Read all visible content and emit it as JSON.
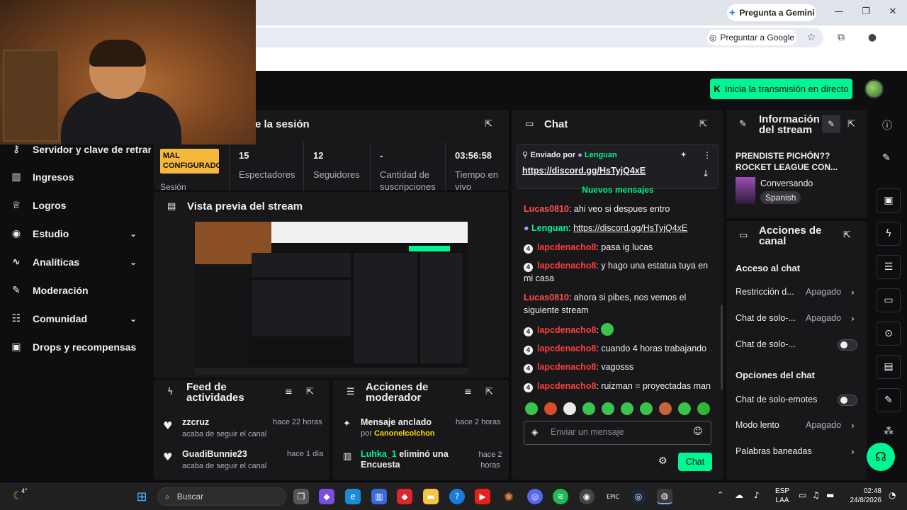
{
  "browser": {
    "gemini_label": "Pregunta a Gemini",
    "ask_google_label": "Preguntar a Google"
  },
  "header": {
    "go_live_label": "Inicia la transmisión en directo"
  },
  "sidebar": {
    "items": [
      {
        "label": "Servidor y clave de retrans",
        "icon": "key-icon"
      },
      {
        "label": "Ingresos",
        "icon": "chart-icon"
      },
      {
        "label": "Logros",
        "icon": "trophy-icon"
      },
      {
        "label": "Estudio",
        "icon": "camera-icon"
      },
      {
        "label": "Analíticas",
        "icon": "analytics-icon"
      },
      {
        "label": "Moderación",
        "icon": "wrench-icon"
      },
      {
        "label": "Comunidad",
        "icon": "people-icon"
      },
      {
        "label": "Drops y recompensas",
        "icon": "gift-icon"
      }
    ]
  },
  "session": {
    "title": "e la sesión",
    "status_badge": "MAL CONFIGURADO",
    "status_label": "Sesión",
    "stats": [
      {
        "value": "15",
        "label": "Espectadores"
      },
      {
        "value": "12",
        "label": "Seguidores"
      },
      {
        "value": "-",
        "label": "Cantidad de suscripciones"
      },
      {
        "value": "03:56:58",
        "label": "Tiempo en vivo"
      }
    ]
  },
  "preview": {
    "title": "Vista previa del stream"
  },
  "activity_feed": {
    "title": "Feed de actividades",
    "items": [
      {
        "user": "zzcruz",
        "action": "acaba de seguir el canal",
        "time": "hace 22 horas"
      },
      {
        "user": "GuadiBunnie23",
        "action": "acaba de seguir el canal",
        "time": "hace 1 día"
      }
    ]
  },
  "mod_actions": {
    "title": "Acciones de moderador",
    "items": [
      {
        "text": "Mensaje anclado",
        "by_prefix": "por ",
        "by": "Canonelcolchon",
        "time": "hace 2 horas"
      },
      {
        "user": "Luhka_1",
        "text": " eliminó una Encuesta",
        "time": "hace 2 horas"
      }
    ]
  },
  "chat": {
    "title": "Chat",
    "pinned_prefix": "Enviado por",
    "pinned_user": "Lenguan",
    "pinned_link": "https://discord.gg/HsTyjQ4xE",
    "new_messages": "Nuevos mensajes",
    "messages": [
      {
        "user": "Lucas0810",
        "text": ": ahi veo si despues entro",
        "color": "#ff4f4f",
        "badge": false
      },
      {
        "user": "Lenguan",
        "text": ": ",
        "link": "https://discord.gg/HsTyjQ4xE",
        "color": "#00f593",
        "badge": false
      },
      {
        "user": "lapcdenacho8",
        "text": ": pasa ig lucas",
        "color": "#ff3b3b",
        "badge": true
      },
      {
        "user": "lapcdenacho8",
        "text": ": y hago una estatua tuya en mi casa",
        "color": "#ff3b3b",
        "badge": true
      },
      {
        "user": "Lucas0810",
        "text": ": ahora si pibes, nos vemos el siguiente stream",
        "color": "#ff4f4f",
        "badge": false
      },
      {
        "user": "lapcdenacho8",
        "text": ": ",
        "color": "#ff3b3b",
        "badge": true
      },
      {
        "user": "lapcdenacho8",
        "text": ": cuando 4 horas trabajando",
        "color": "#ff3b3b",
        "badge": true
      },
      {
        "user": "lapcdenacho8",
        "text": ": vagosss",
        "color": "#ff3b3b",
        "badge": true
      },
      {
        "user": "lapcdenacho8",
        "text": ": ruizman = proyectadas man",
        "color": "#ff3b3b",
        "badge": true
      }
    ],
    "input_placeholder": "Enviar un mensaje",
    "send_label": "Chat"
  },
  "stream_info": {
    "title": "Información del stream",
    "stream_title": "PRENDISTE PICHÓN?? ROCKET LEAGUE CON...",
    "category": "Conversando",
    "language": "Spanish"
  },
  "channel_actions": {
    "title": "Acciones de canal",
    "chat_access_heading": "Acceso al chat",
    "rows_access": [
      {
        "label": "Restricción d...",
        "value": "Apagado"
      },
      {
        "label": "Chat de solo-...",
        "value": "Apagado"
      },
      {
        "label": "Chat de solo-...",
        "value": ""
      }
    ],
    "options_heading": "Opciones del chat",
    "rows_options": [
      {
        "label": "Chat de solo-emotes",
        "value": ""
      },
      {
        "label": "Modo lento",
        "value": "Apagado"
      },
      {
        "label": "Palabras baneadas",
        "value": ""
      }
    ]
  },
  "taskbar": {
    "search_placeholder": "Buscar",
    "weather": "4°",
    "lang_line1": "ESP",
    "lang_line2": "LAA",
    "time": "02:48",
    "date": "24/8/2026"
  }
}
